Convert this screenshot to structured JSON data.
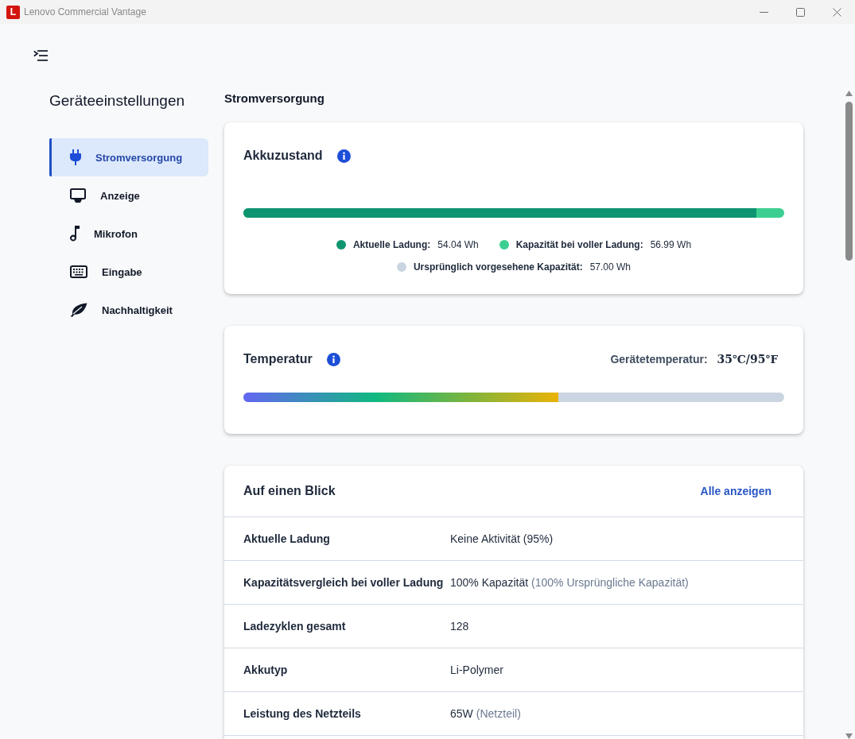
{
  "window": {
    "logo": "L",
    "title": "Lenovo Commercial Vantage"
  },
  "sidebar": {
    "title": "Geräteeinstellungen",
    "items": [
      {
        "label": "Stromversorgung",
        "selected": true
      },
      {
        "label": "Anzeige",
        "selected": false
      },
      {
        "label": "Mikrofon",
        "selected": false
      },
      {
        "label": "Eingabe",
        "selected": false
      },
      {
        "label": "Nachhaltigkeit",
        "selected": false
      }
    ]
  },
  "page_title": "Stromversorgung",
  "battery_card": {
    "title": "Akkuzustand",
    "bar": {
      "level": 0.948
    },
    "legend": [
      {
        "label": "Aktuelle Ladung:",
        "value": "54.04 Wh",
        "color": "#0f9470"
      },
      {
        "label": "Kapazität bei voller Ladung:",
        "value": "56.99 Wh",
        "color": "#3ccf91"
      },
      {
        "label": "Ursprünglich vorgesehene Kapazität:",
        "value": "57.00 Wh",
        "color": "#cbd5e1"
      }
    ]
  },
  "temperature_card": {
    "title": "Temperatur",
    "reading_label": "Gerätetemperatur:",
    "reading": "35℃/95℉",
    "bar": {
      "level": 0.582
    }
  },
  "overview_card": {
    "title": "Auf einen Blick",
    "link": "Alle anzeigen",
    "rows": [
      {
        "label": "Aktuelle Ladung",
        "value": "Keine Aktivität (95%)"
      },
      {
        "label": "Kapazitätsvergleich bei voller Ladung",
        "value": "100% Kapazität",
        "note": "(100% Ursprüngliche Kapazität)"
      },
      {
        "label": "Ladezyklen gesamt",
        "value": "128"
      },
      {
        "label": "Akkutyp",
        "value": "Li-Polymer"
      },
      {
        "label": "Leistung des Netzteils",
        "value": "65W",
        "note": "(Netzteil)"
      }
    ]
  }
}
